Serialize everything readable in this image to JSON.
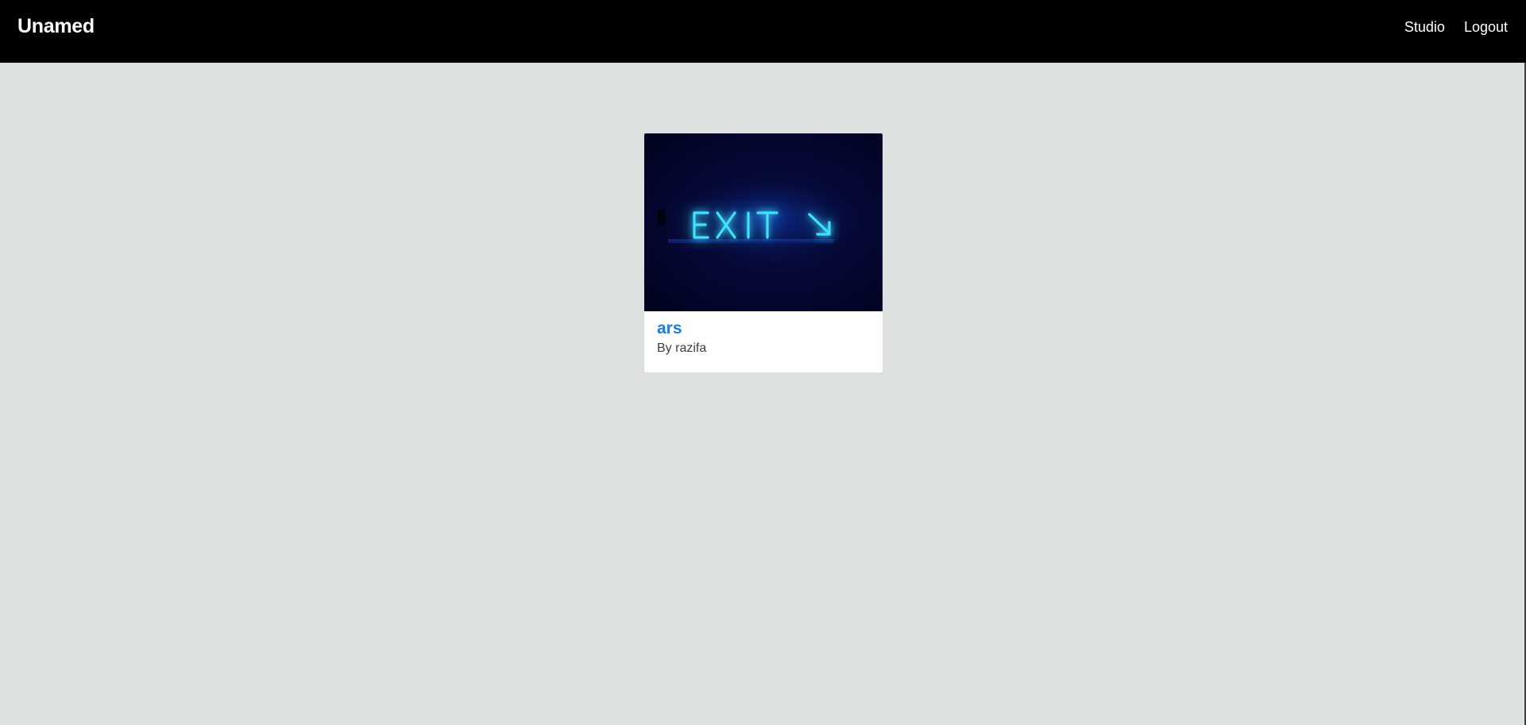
{
  "navbar": {
    "brand": "Unamed",
    "links": [
      {
        "label": "Studio"
      },
      {
        "label": "Logout"
      }
    ]
  },
  "cards": [
    {
      "title": "ars",
      "author_text": "By razifa",
      "image": {
        "subject": "neon sign",
        "sign_text": "EXIT",
        "arrow_icon": "arrow-down-right-icon",
        "glow_color": "#1e90ff",
        "background_color": "#03052a"
      }
    }
  ],
  "colors": {
    "navbar_bg": "#000000",
    "page_bg": "#dce0df",
    "link_accent": "#1b7ee8"
  }
}
